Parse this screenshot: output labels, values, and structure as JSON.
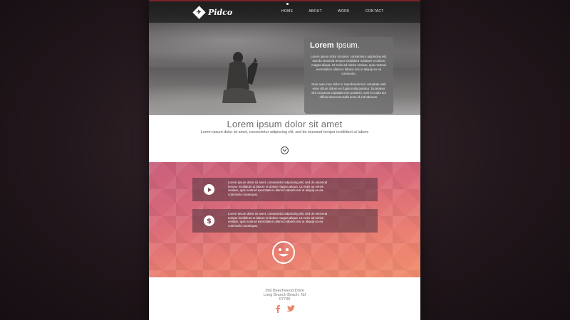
{
  "logo": {
    "mark": "✈",
    "text": "Pidco"
  },
  "nav": {
    "items": [
      {
        "label": "HOME"
      },
      {
        "label": "ABOUT"
      },
      {
        "label": "WORK"
      },
      {
        "label": "CONTACT"
      }
    ],
    "active": "HOME"
  },
  "hero": {
    "card": {
      "title_bold": "Lorem",
      "title_rest": "Ipsum.",
      "para1": "Lorem ipsum dolor sit amet, consectetur adipiscing elit, sed do eiusmod tempor incididunt ut labore et dolore magna aliqua. Ut enim ad minim veniam, quis nostrud exercitation ullamco laboris nisi ut aliquip ex ea commodo.",
      "para2": "Duis aute irure dolor in reprehenderit in voluptate velit esse cillum dolore eu fugiat nulla pariatur. Excepteur sint occaecat cupidatat non proident, sunt in culpa qui officia deserunt mollit anim id est laborum."
    }
  },
  "intro": {
    "heading": "Lorem ipsum dolor sit amet",
    "subheading": "Lorem ipsum dolor sit amet, consectetur adipiscing elit, sed do eiusmod tempor incididunt ut labore"
  },
  "features": {
    "items": [
      {
        "icon": "play-icon",
        "text": "Lorem ipsum dolor sit amet, consectetur adipiscing elit, sed do eiusmod tempor incididunt ut labore et dolore magna aliqua. Ut enim ad minim veniam, quis nostrud exercitation ullamco laboris nisi ut aliquip ex ea commodo consequat."
      },
      {
        "icon": "dollar-icon",
        "text": "Lorem ipsum dolor sit amet, consectetur adipiscing elit, sed do eiusmod tempor incididunt ut labore et dolore magna aliqua. Ut enim ad minim veniam, quis nostrud exercitation ullamco laboris nisi ut aliquip ex ea commodo consequat."
      }
    ]
  },
  "footer": {
    "address_line1": "290 Beechwood Drive",
    "address_line2": "Long Branch Beach, NJ",
    "address_line3": "07740"
  },
  "colors": {
    "accent_gradient_start": "#c9607b",
    "accent_gradient_end": "#f08d6d",
    "facebook": "#e8866a",
    "twitter": "#e8866a"
  }
}
